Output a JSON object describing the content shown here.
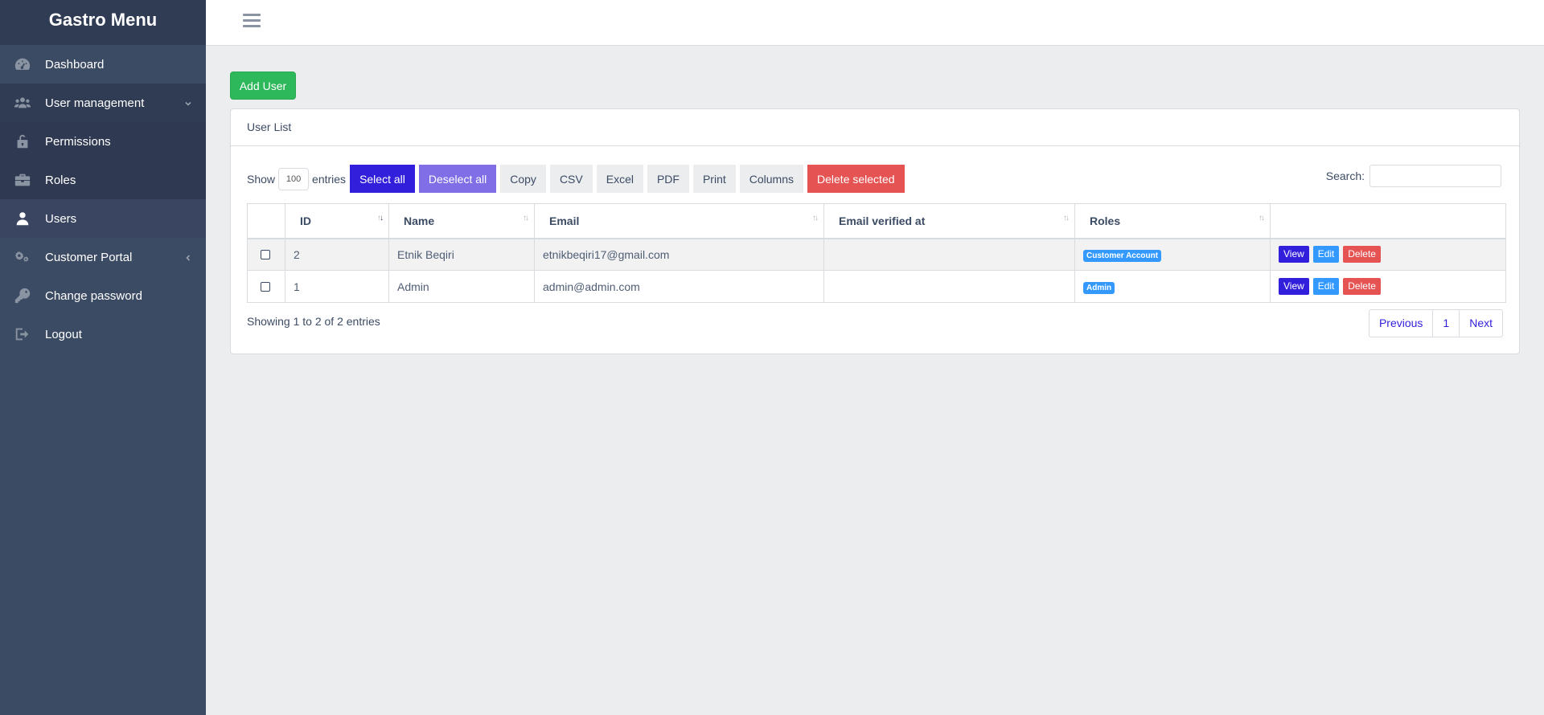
{
  "sidebar": {
    "brand": "Gastro Menu",
    "items": [
      {
        "label": "Dashboard",
        "icon": "speedometer-icon"
      },
      {
        "label": "User management",
        "icon": "people-icon"
      },
      {
        "label": "Permissions",
        "icon": "lock-unlocked-icon"
      },
      {
        "label": "Roles",
        "icon": "briefcase-icon"
      },
      {
        "label": "Users",
        "icon": "user-icon"
      },
      {
        "label": "Customer Portal",
        "icon": "settings-icon"
      },
      {
        "label": "Change password",
        "icon": "key-icon"
      },
      {
        "label": "Logout",
        "icon": "account-logout-icon"
      }
    ]
  },
  "main": {
    "add_user_label": "Add User",
    "card_title": "User List",
    "show_label": "Show",
    "page_length": "100",
    "entries_label": "entries",
    "toolbar": {
      "select_all": "Select all",
      "deselect_all": "Deselect all",
      "copy": "Copy",
      "csv": "CSV",
      "excel": "Excel",
      "pdf": "PDF",
      "print": "Print",
      "columns": "Columns",
      "delete_selected": "Delete selected"
    },
    "search_label": "Search:",
    "search_value": "",
    "table": {
      "headers": [
        "",
        "ID",
        "Name",
        "Email",
        "Email verified at",
        "Roles",
        ""
      ],
      "rows": [
        {
          "id": "2",
          "name": "Etnik Beqiri",
          "email": "etnikbeqiri17@gmail.com",
          "verified": "",
          "role": "Customer Account"
        },
        {
          "id": "1",
          "name": "Admin",
          "email": "admin@admin.com",
          "verified": "",
          "role": "Admin"
        }
      ],
      "actions": {
        "view": "View",
        "edit": "Edit",
        "delete": "Delete"
      }
    },
    "info": "Showing 1 to 2 of 2 entries",
    "pagination": {
      "previous": "Previous",
      "page": "1",
      "next": "Next"
    }
  },
  "colors": {
    "sidebar_bg": "#3c4b64",
    "primary": "#321fdb",
    "success": "#2eb85c",
    "danger": "#e55353",
    "info": "#3399ff"
  }
}
